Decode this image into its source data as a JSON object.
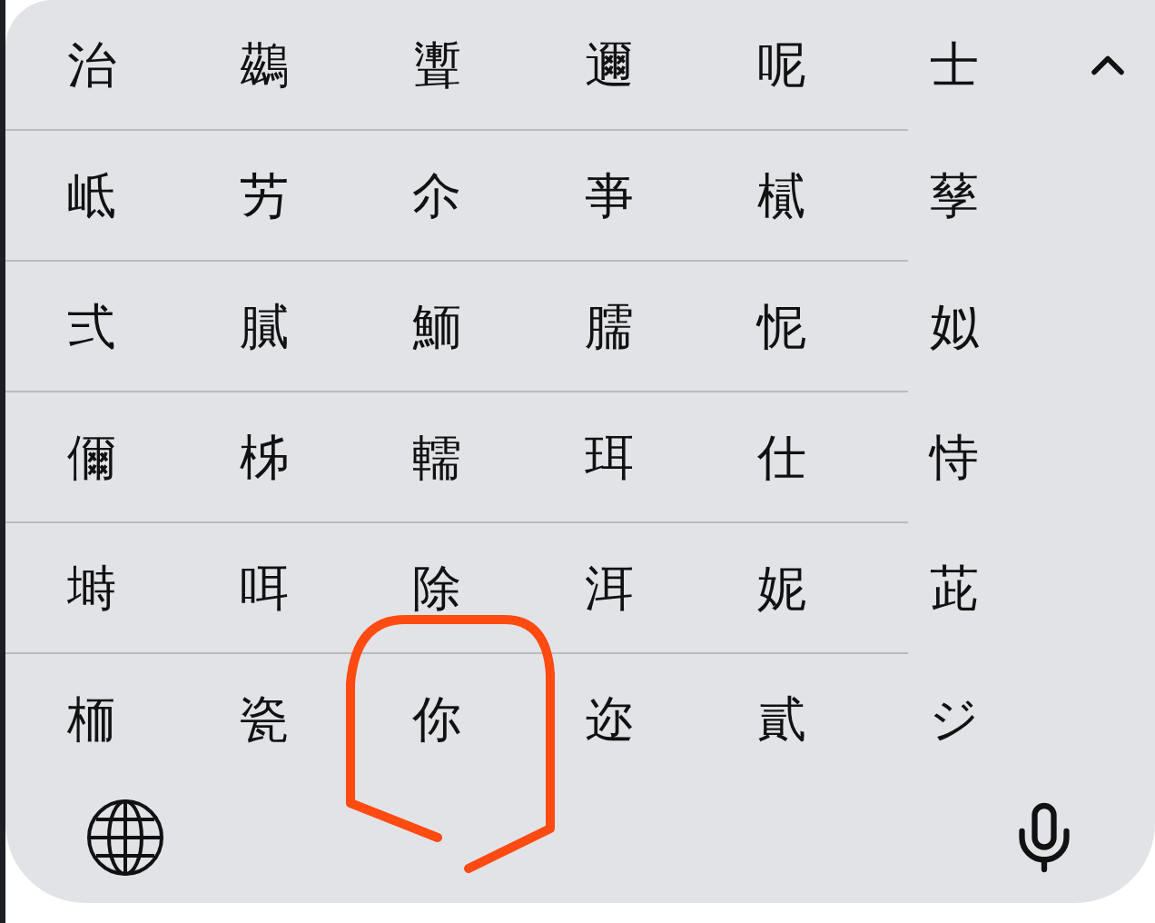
{
  "candidate_rows": [
    {
      "candidates": [
        {
          "text": "治",
          "circled": false
        },
        {
          "text": "鷀",
          "circled": false
        },
        {
          "text": "聻",
          "circled": false
        },
        {
          "text": "邇",
          "circled": false
        },
        {
          "text": "呢",
          "circled": false
        },
        {
          "text": "士",
          "circled": false
        }
      ]
    },
    {
      "candidates": [
        {
          "text": "岻",
          "circled": false
        },
        {
          "text": "艻",
          "circled": false
        },
        {
          "text": "尒",
          "circled": false
        },
        {
          "text": "亊",
          "circled": false
        },
        {
          "text": "樲",
          "circled": false
        },
        {
          "text": "孶",
          "circled": false
        }
      ]
    },
    {
      "candidates": [
        {
          "text": "弍",
          "circled": false
        },
        {
          "text": "膩",
          "circled": false
        },
        {
          "text": "鮞",
          "circled": false
        },
        {
          "text": "臑",
          "circled": false
        },
        {
          "text": "怩",
          "circled": false
        },
        {
          "text": "姒",
          "circled": false
        }
      ]
    },
    {
      "candidates": [
        {
          "text": "儞",
          "circled": false
        },
        {
          "text": "柹",
          "circled": false
        },
        {
          "text": "轜",
          "circled": false
        },
        {
          "text": "珥",
          "circled": false
        },
        {
          "text": "仕",
          "circled": false
        },
        {
          "text": "恃",
          "circled": false
        }
      ]
    },
    {
      "candidates": [
        {
          "text": "塒",
          "circled": false
        },
        {
          "text": "咡",
          "circled": false
        },
        {
          "text": "除",
          "circled": false
        },
        {
          "text": "洱",
          "circled": false
        },
        {
          "text": "妮",
          "circled": false
        },
        {
          "text": "茈",
          "circled": false
        }
      ]
    },
    {
      "candidates": [
        {
          "text": "栭",
          "circled": false
        },
        {
          "text": "瓷",
          "circled": false
        },
        {
          "text": "你",
          "circled": true
        },
        {
          "text": "迩",
          "circled": false
        },
        {
          "text": "貳",
          "circled": false
        },
        {
          "text": "ジ",
          "circled": false
        }
      ]
    }
  ]
}
